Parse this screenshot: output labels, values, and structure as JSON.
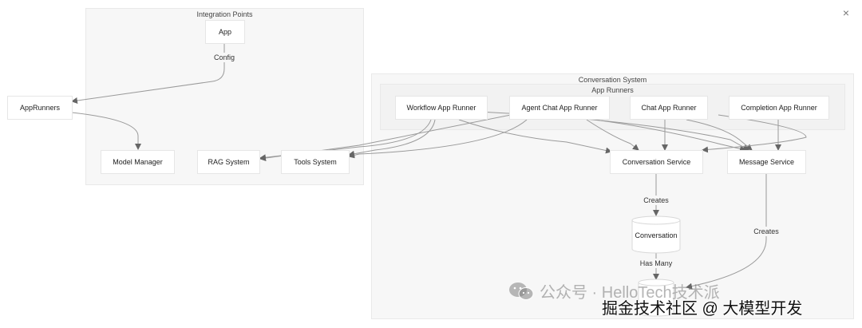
{
  "clusters": {
    "integration": {
      "title": "Integration Points"
    },
    "conversation": {
      "title": "Conversation System"
    },
    "app_runners": {
      "title": "App Runners"
    }
  },
  "nodes": {
    "app": "App",
    "app_runners": "AppRunners",
    "model_manager": "Model Manager",
    "rag_system": "RAG System",
    "tools_system": "Tools System",
    "workflow_runner": "Workflow App Runner",
    "agent_chat_runner": "Agent Chat App Runner",
    "chat_runner": "Chat App Runner",
    "completion_runner": "Completion App Runner",
    "conversation_service": "Conversation Service",
    "message_service": "Message Service",
    "conversation_db": "Conversation"
  },
  "edge_labels": {
    "config": "Config",
    "creates_1": "Creates",
    "creates_2": "Creates",
    "has_many": "Has Many"
  },
  "watermark": {
    "line1": "公众号 · HelloTech技术派",
    "line2": "掘金技术社区 @ 大模型开发"
  },
  "close_icon": "×"
}
